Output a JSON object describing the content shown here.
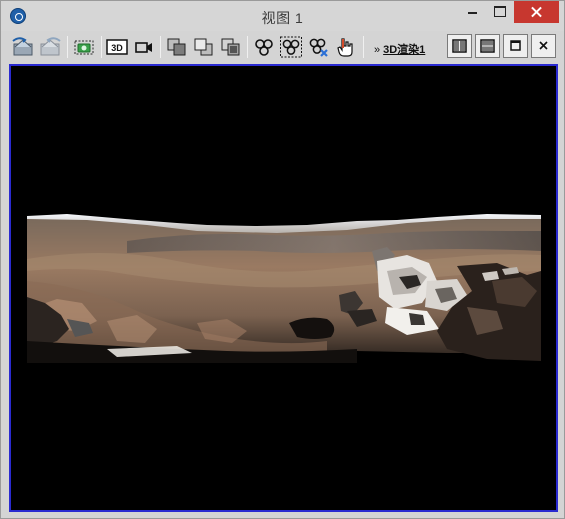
{
  "window": {
    "title": "视图 1"
  },
  "toolbar": {
    "render_link_chevron": "»",
    "render_link_label": "3D渲染1",
    "buttons": [
      {
        "name": "pan-left-view-icon"
      },
      {
        "name": "pan-right-view-icon"
      },
      {
        "name": "snapshot-camera-icon"
      },
      {
        "name": "3d-view-icon"
      },
      {
        "name": "video-camera-icon"
      },
      {
        "name": "bring-to-front-icon"
      },
      {
        "name": "send-to-back-icon"
      },
      {
        "name": "stack-layers-icon"
      },
      {
        "name": "group-nodes-icon"
      },
      {
        "name": "select-nodes-icon"
      },
      {
        "name": "remove-nodes-icon"
      },
      {
        "name": "hand-pointer-icon"
      }
    ],
    "layouts": [
      {
        "name": "split-vertical-icon"
      },
      {
        "name": "split-horizontal-icon"
      },
      {
        "name": "single-view-icon"
      },
      {
        "name": "close-view-icon"
      }
    ]
  },
  "colors": {
    "viewport_border": "#2a2ad0",
    "viewport_bg": "#000000",
    "close_button": "#c7372f"
  }
}
